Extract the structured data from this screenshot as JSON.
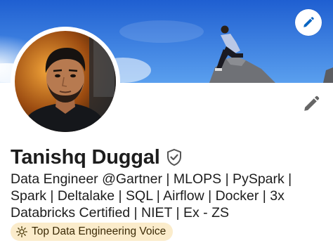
{
  "profile": {
    "name": "Tanishq Duggal",
    "headline_lines": [
      "Data Engineer @Gartner | MLOPS | PySpark |",
      "Spark | Deltalake | SQL | Airflow | Docker | 3x",
      "Databricks Certified | NIET | Ex - ZS"
    ],
    "badge_label": "Top Data Engineering Voice"
  },
  "icons": {
    "banner_edit": "pencil-icon",
    "profile_edit": "pencil-icon",
    "verified": "shield-check-icon",
    "badge": "sun-icon"
  },
  "colors": {
    "sky_top": "#1f5fd1",
    "sky_bottom": "#4f98ea",
    "accent_blue": "#0a66c2",
    "badge_bg": "#fbeccb",
    "text": "#1d1d1d",
    "icon_gray": "#666666"
  }
}
